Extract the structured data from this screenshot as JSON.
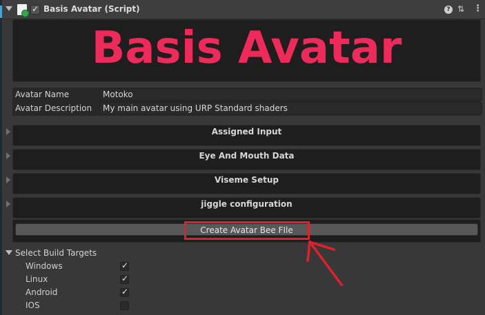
{
  "component": {
    "title": "Basis Avatar (Script)",
    "enabled_mark": "✓",
    "help_glyph": "?",
    "presets_glyph": "⇅",
    "kebab_glyph": "⋮"
  },
  "banner": {
    "title": "Basis Avatar",
    "color": "#ee2a5a"
  },
  "fields": {
    "name_label": "Avatar Name",
    "name_value": "Motoko",
    "description_label": "Avatar Description",
    "description_value": "My main avatar using URP Standard shaders"
  },
  "sections": [
    {
      "label": "Assigned Input"
    },
    {
      "label": "Eye And Mouth Data"
    },
    {
      "label": "Viseme Setup"
    },
    {
      "label": "jiggle configuration"
    }
  ],
  "create_button_label": "Create Avatar Bee FIle",
  "annotation_color": "#e0202a",
  "build_targets": {
    "heading": "Select Build Targets",
    "items": [
      {
        "label": "Windows",
        "checked": true,
        "mark": "✓"
      },
      {
        "label": "Linux",
        "checked": true,
        "mark": "✓"
      },
      {
        "label": "Android",
        "checked": true,
        "mark": "✓"
      },
      {
        "label": "IOS",
        "checked": false,
        "mark": ""
      }
    ]
  },
  "icons": [
    "script-icon",
    "help-icon",
    "presets-icon",
    "kebab-icon",
    "red-arrow-annotation"
  ]
}
